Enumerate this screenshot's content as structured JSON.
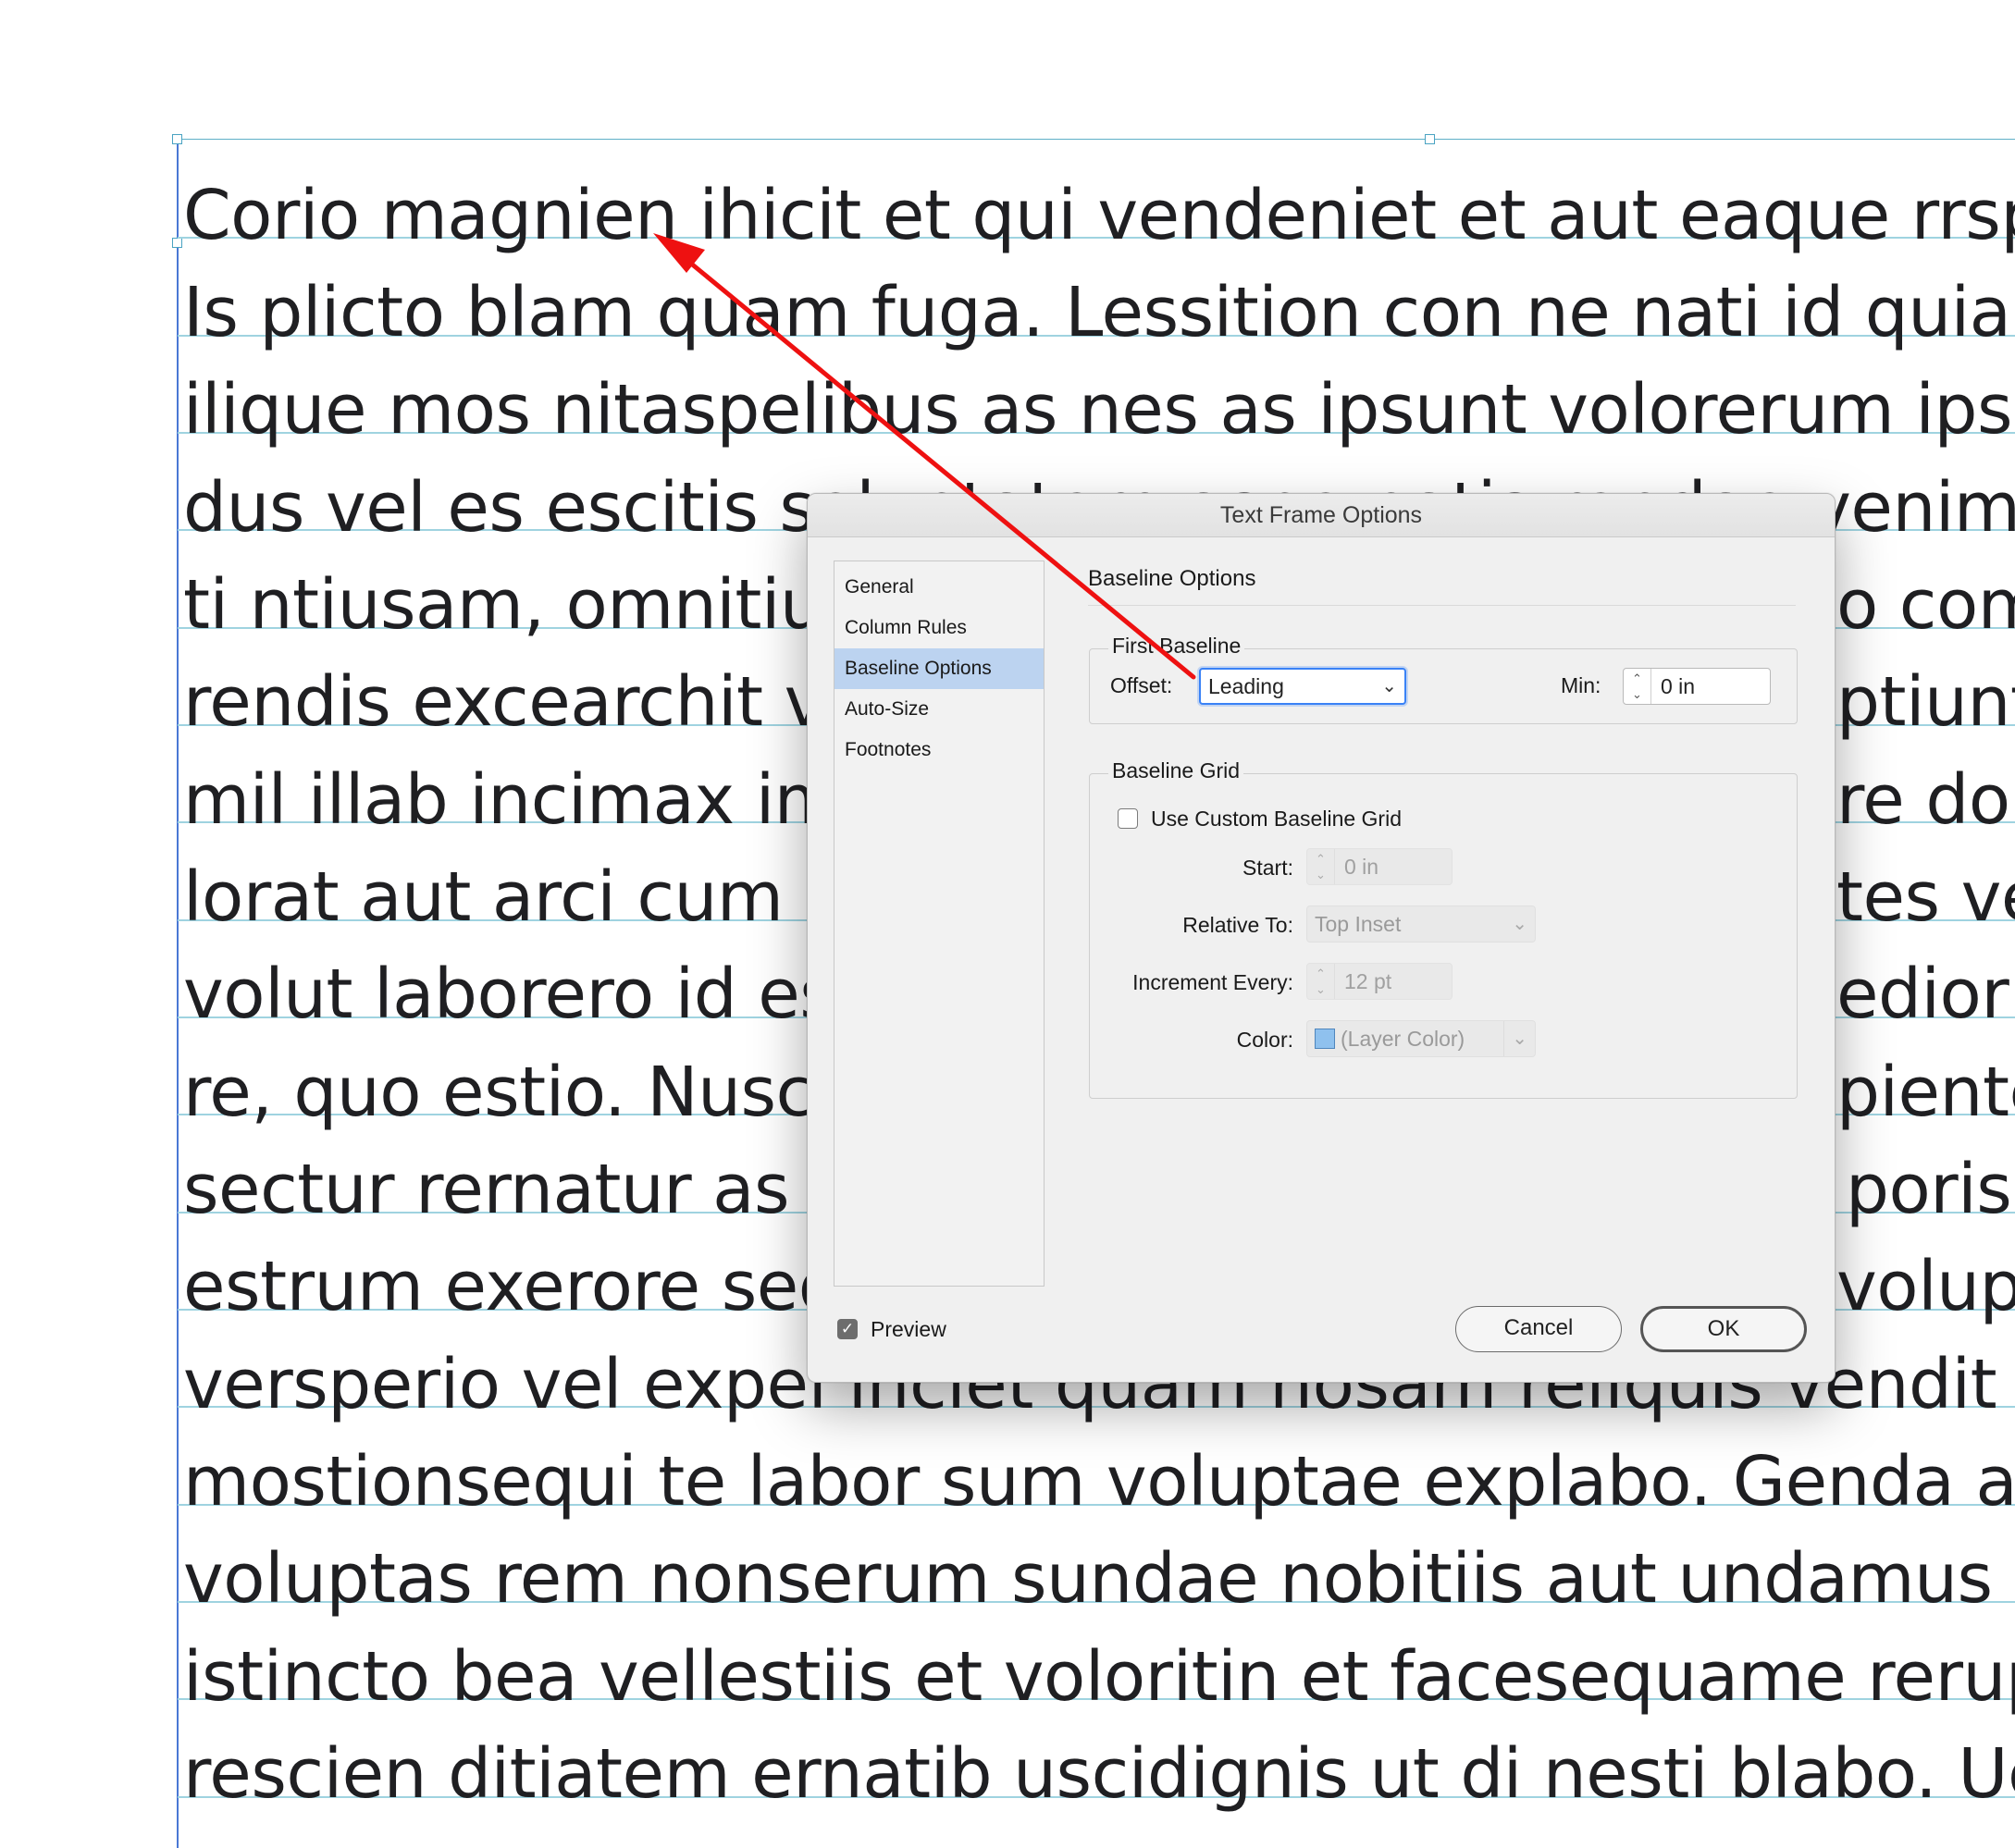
{
  "document": {
    "lines": [
      "Corio magnien ihicit et qui vendeniet et aut eaque rrsperibus",
      "Is plicto blam quam fuga. Lessition con ne nati id quia volessi",
      "ilique mos nitaspelibus as nes as ipsunt volorerum ipsanda no",
      "dus vel es escitis soluptatem aspe natis rendae venimporet et a d",
      "ti ntiusam, omnitium",
      "rendis excearchit ve",
      "mil illab incimax imp",
      "lorat aut arci cum co",
      "volut laborero id est",
      "re, quo estio. Nuscia",
      "sectur rernatur as q",
      "estrum exerore sequ",
      "versperio vel expel inciet quam nosam reliquis vendit rerfer",
      "mostionsequi te labor sum voluptae explabo. Genda aspelen",
      "voluptas rem nonserum sundae nobitiis aut undamus eum qu",
      "istincto bea vellestiis et voloritin et facesequame reruptamu",
      "rescien ditiatem ernatib uscidignis ut di nesti blabo. Ucius r"
    ],
    "right_fragments": [
      "o com",
      "ptiunt",
      "re dole",
      "tes ve",
      "edior s",
      "piente",
      "poris",
      "volupt"
    ]
  },
  "dialog": {
    "title": "Text Frame Options",
    "sidebar": [
      {
        "label": "General",
        "selected": false
      },
      {
        "label": "Column Rules",
        "selected": false
      },
      {
        "label": "Baseline Options",
        "selected": true
      },
      {
        "label": "Auto-Size",
        "selected": false
      },
      {
        "label": "Footnotes",
        "selected": false
      }
    ],
    "section_title": "Baseline Options",
    "first_baseline": {
      "group_label": "First Baseline",
      "offset_label": "Offset:",
      "offset_value": "Leading",
      "min_label": "Min:",
      "min_value": "0 in"
    },
    "baseline_grid": {
      "group_label": "Baseline Grid",
      "use_custom_label": "Use Custom Baseline Grid",
      "use_custom_checked": false,
      "start_label": "Start:",
      "start_value": "0 in",
      "relative_label": "Relative To:",
      "relative_value": "Top Inset",
      "increment_label": "Increment Every:",
      "increment_value": "12 pt",
      "color_label": "Color:",
      "color_value": "(Layer Color)",
      "color_swatch": "#8fc1ee"
    },
    "preview_label": "Preview",
    "preview_checked": true,
    "cancel_label": "Cancel",
    "ok_label": "OK"
  },
  "colors": {
    "annotation_arrow": "#ee1111",
    "baseline_grid": "#9fd3e0",
    "frame_edge": "#4a78d4",
    "selection": "#bcd3f0"
  }
}
